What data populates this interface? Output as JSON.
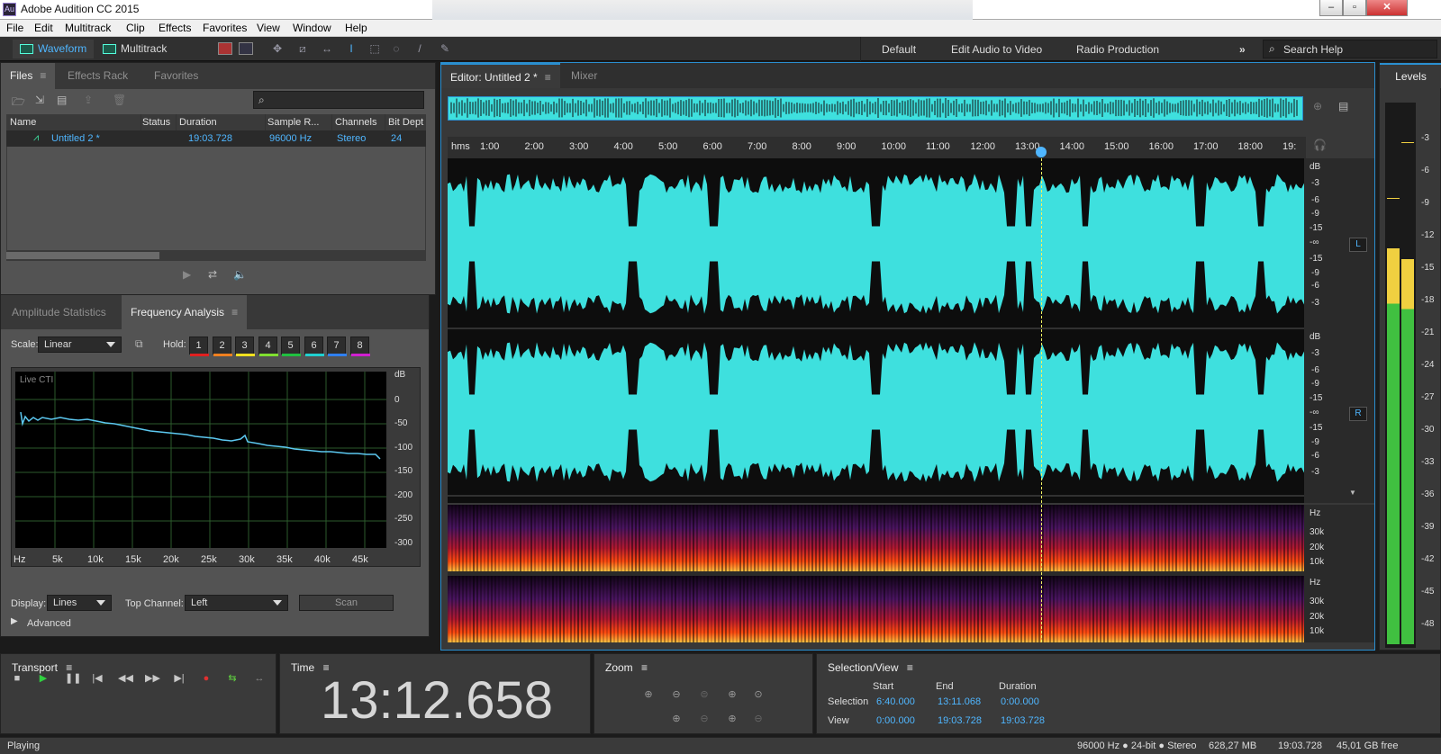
{
  "app": {
    "title": "Adobe Audition CC 2015",
    "logo": "Au",
    "window_buttons": [
      "–",
      "▫",
      "✕"
    ]
  },
  "menu": [
    "File",
    "Edit",
    "Multitrack",
    "Clip",
    "Effects",
    "Favorites",
    "View",
    "Window",
    "Help"
  ],
  "toolbar": {
    "waveform_label": "Waveform",
    "multitrack_label": "Multitrack",
    "tools": [
      "spectral-frequency-icon",
      "spectral-pitch-icon",
      "move-tool-icon",
      "razor-tool-icon",
      "slip-tool-icon",
      "time-selection-icon",
      "marquee-icon",
      "lasso-icon",
      "brush-icon",
      "spot-healing-icon"
    ],
    "workspaces": [
      "Default",
      "Edit Audio to Video",
      "Radio Production"
    ],
    "more": "»",
    "search_placeholder": "Search Help"
  },
  "files_panel": {
    "tabs": [
      "Files",
      "Effects Rack",
      "Favorites"
    ],
    "columns": [
      "Name",
      "Status",
      "Duration",
      "Sample R...",
      "Channels",
      "Bit Dept"
    ],
    "rows": [
      {
        "name": "Untitled 2 *",
        "status": "",
        "duration": "19:03.728",
        "sample_rate": "96000 Hz",
        "channels": "Stereo",
        "bit_depth": "24"
      }
    ]
  },
  "analysis_panel": {
    "tabs": [
      "Amplitude Statistics",
      "Frequency Analysis"
    ],
    "scale_label": "Scale:",
    "scale_value": "Linear",
    "hold_label": "Hold:",
    "hold_buttons": [
      {
        "label": "1",
        "color": "#e02020"
      },
      {
        "label": "2",
        "color": "#f08020"
      },
      {
        "label": "3",
        "color": "#f0e020"
      },
      {
        "label": "4",
        "color": "#80e030"
      },
      {
        "label": "5",
        "color": "#20c040"
      },
      {
        "label": "6",
        "color": "#20d0d0"
      },
      {
        "label": "7",
        "color": "#3080f0"
      },
      {
        "label": "8",
        "color": "#d020d0"
      }
    ],
    "graph_label": "Live CTI",
    "db_unit": "dB",
    "db_ticks": [
      "0",
      "-50",
      "-100",
      "-150",
      "-200",
      "-250",
      "-300"
    ],
    "hz_ticks": [
      "Hz",
      "5k",
      "10k",
      "15k",
      "20k",
      "25k",
      "30k",
      "35k",
      "40k",
      "45k"
    ],
    "display_label": "Display:",
    "display_value": "Lines",
    "top_channel_label": "Top Channel:",
    "top_channel_value": "Left",
    "scan_label": "Scan",
    "advanced_label": "Advanced"
  },
  "editor": {
    "tab_label": "Editor: Untitled 2 *",
    "mixer_label": "Mixer",
    "ruler_unit": "hms",
    "ruler_ticks": [
      "1:00",
      "2:00",
      "3:00",
      "4:00",
      "5:00",
      "6:00",
      "7:00",
      "8:00",
      "9:00",
      "10:00",
      "11:00",
      "12:00",
      "13:00",
      "14:00",
      "15:00",
      "16:00",
      "17:00",
      "18:00",
      "19:"
    ],
    "playhead_fraction": 0.6925,
    "channel_L": "L",
    "channel_R": "R",
    "db_unit": "dB",
    "db_ticks": [
      "-3",
      "-6",
      "-9",
      "-15",
      "-∞",
      "-15",
      "-9",
      "-6",
      "-3"
    ],
    "hz_unit": "Hz",
    "hz_ticks": [
      "30k",
      "20k",
      "10k"
    ],
    "waveform_color": "#3ee0de"
  },
  "levels": {
    "title": "Levels",
    "ticks": [
      "-3",
      "-6",
      "-9",
      "-12",
      "-15",
      "-18",
      "-21",
      "-24",
      "-27",
      "-30",
      "-33",
      "-36",
      "-39",
      "-42",
      "-45",
      "-48"
    ],
    "left_level_fraction": 0.735,
    "right_level_fraction": 0.715
  },
  "transport": {
    "title": "Transport",
    "buttons": [
      "■",
      "▶",
      "❚❚",
      "|◀",
      "◀◀",
      "▶▶",
      "▶|",
      "●",
      "⇆",
      "↔"
    ]
  },
  "time": {
    "title": "Time",
    "value": "13:12.658"
  },
  "zoom": {
    "title": "Zoom"
  },
  "selection_view": {
    "title": "Selection/View",
    "col_start": "Start",
    "col_end": "End",
    "col_duration": "Duration",
    "selection_label": "Selection",
    "selection_start": "6:40.000",
    "selection_end": "13:11.068",
    "selection_duration": "0:00.000",
    "view_label": "View",
    "view_start": "0:00.000",
    "view_end": "19:03.728",
    "view_duration": "19:03.728"
  },
  "statusbar": {
    "state": "Playing",
    "format": "96000 Hz ● 24-bit ● Stereo",
    "size": "628,27 MB",
    "duration": "19:03.728",
    "free": "45,01 GB free"
  }
}
